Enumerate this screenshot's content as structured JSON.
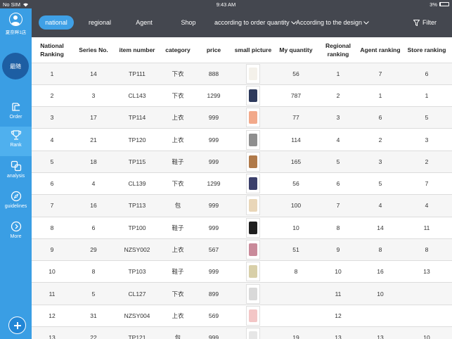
{
  "status": {
    "carrier": "No SIM",
    "time": "9:43 AM",
    "battery": "3%"
  },
  "sidebar": {
    "store_name": "夏奈畔1店",
    "quick_label": "最随",
    "items": [
      {
        "label": "Order",
        "icon": "order-icon"
      },
      {
        "label": "Rank",
        "icon": "trophy-icon"
      },
      {
        "label": "analysis",
        "icon": "analysis-icon"
      },
      {
        "label": "guidelines",
        "icon": "compass-icon"
      },
      {
        "label": "More",
        "icon": "chevron-right-circle-icon"
      }
    ]
  },
  "topbar": {
    "tabs": [
      "national",
      "regional",
      "Agent",
      "Shop"
    ],
    "active_tab": "national",
    "sort1": "according to order quantity",
    "sort2": "According to the design",
    "filter": "Filter"
  },
  "table": {
    "headers": [
      "National Ranking",
      "Series No.",
      "item number",
      "category",
      "price",
      "small picture",
      "My quantity",
      "Regional ranking",
      "Agent ranking",
      "Store ranking"
    ],
    "rows": [
      {
        "national": "1",
        "series": "14",
        "item": "TP111",
        "category": "下衣",
        "price": "888",
        "color": "#f4f1ea",
        "qty": "56",
        "regional": "1",
        "agent": "7",
        "store": "6"
      },
      {
        "national": "2",
        "series": "3",
        "item": "CL143",
        "category": "下衣",
        "price": "1299",
        "color": "#2e3a5c",
        "qty": "787",
        "regional": "2",
        "agent": "1",
        "store": "1"
      },
      {
        "national": "3",
        "series": "17",
        "item": "TP114",
        "category": "上衣",
        "price": "999",
        "color": "#f2a98a",
        "qty": "77",
        "regional": "3",
        "agent": "6",
        "store": "5"
      },
      {
        "national": "4",
        "series": "21",
        "item": "TP120",
        "category": "上衣",
        "price": "999",
        "color": "#8e8e8e",
        "qty": "114",
        "regional": "4",
        "agent": "2",
        "store": "3"
      },
      {
        "national": "5",
        "series": "18",
        "item": "TP115",
        "category": "鞋子",
        "price": "999",
        "color": "#b07a4a",
        "qty": "165",
        "regional": "5",
        "agent": "3",
        "store": "2"
      },
      {
        "national": "6",
        "series": "4",
        "item": "CL139",
        "category": "下衣",
        "price": "1299",
        "color": "#3b3f6b",
        "qty": "56",
        "regional": "6",
        "agent": "5",
        "store": "7"
      },
      {
        "national": "7",
        "series": "16",
        "item": "TP113",
        "category": "包",
        "price": "999",
        "color": "#e9d6b8",
        "qty": "100",
        "regional": "7",
        "agent": "4",
        "store": "4"
      },
      {
        "national": "8",
        "series": "6",
        "item": "TP100",
        "category": "鞋子",
        "price": "999",
        "color": "#1e1e1e",
        "qty": "10",
        "regional": "8",
        "agent": "14",
        "store": "11"
      },
      {
        "national": "9",
        "series": "29",
        "item": "NZSY002",
        "category": "上衣",
        "price": "567",
        "color": "#c98a9a",
        "qty": "51",
        "regional": "9",
        "agent": "8",
        "store": "8"
      },
      {
        "national": "10",
        "series": "8",
        "item": "TP103",
        "category": "鞋子",
        "price": "999",
        "color": "#d8cfa8",
        "qty": "8",
        "regional": "10",
        "agent": "16",
        "store": "13"
      },
      {
        "national": "11",
        "series": "5",
        "item": "CL127",
        "category": "下衣",
        "price": "899",
        "color": "#d9d9d9",
        "qty": "",
        "regional": "11",
        "agent": "10",
        "store": ""
      },
      {
        "national": "12",
        "series": "31",
        "item": "NZSY004",
        "category": "上衣",
        "price": "569",
        "color": "#f3c6c6",
        "qty": "",
        "regional": "12",
        "agent": "",
        "store": ""
      },
      {
        "national": "13",
        "series": "22",
        "item": "TP121",
        "category": "包",
        "price": "999",
        "color": "#e6e6e6",
        "qty": "19",
        "regional": "13",
        "agent": "13",
        "store": "10"
      }
    ]
  }
}
